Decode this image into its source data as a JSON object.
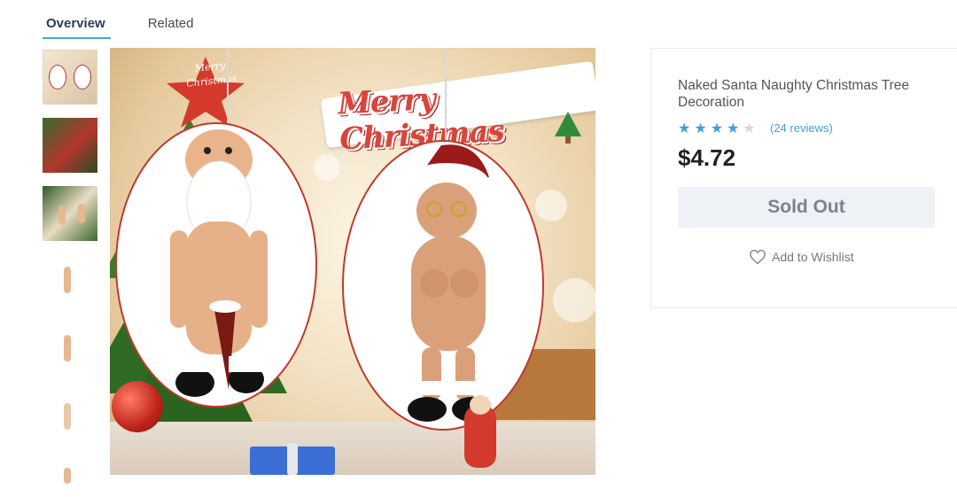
{
  "tabs": [
    {
      "label": "Overview",
      "active": true
    },
    {
      "label": "Related",
      "active": false
    }
  ],
  "thumbnails": [
    {
      "label": "thumbnail-1"
    },
    {
      "label": "thumbnail-2"
    },
    {
      "label": "thumbnail-3"
    },
    {
      "label": "thumbnail-4"
    },
    {
      "label": "thumbnail-5"
    },
    {
      "label": "thumbnail-6"
    },
    {
      "label": "thumbnail-7"
    }
  ],
  "main_image": {
    "banner_text": "Merry Christmas",
    "star_text": "Merry Christmas"
  },
  "product": {
    "title": "Naked Santa Naughty Christmas Tree Decoration",
    "rating": 4,
    "rating_max": 5,
    "reviews": "(24 reviews)",
    "price": "$4.72",
    "button_label": "Sold Out",
    "wishlist_label": "Add to Wishlist"
  },
  "colors": {
    "accent": "#3ea0d8",
    "tab_underline": "#4aa3df",
    "button_bg": "#eef1f6",
    "button_text": "#7a8390",
    "price": "#222222"
  },
  "icons": {
    "wishlist": "heart-outline-icon",
    "rating": "star-icon"
  }
}
